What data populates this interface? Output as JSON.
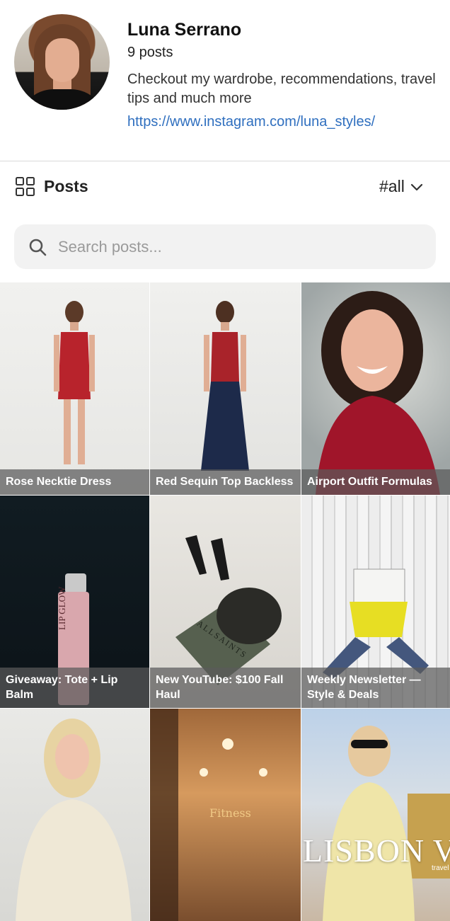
{
  "profile": {
    "name": "Luna Serrano",
    "post_count": "9 posts",
    "bio": "Checkout my wardrobe, recommendations, travel tips and much more",
    "link": "https://www.instagram.com/luna_styles/"
  },
  "posts_bar": {
    "title": "Posts",
    "filter_label": "#all",
    "icons": {
      "grid": "grid-icon",
      "chevron": "chevron-down-icon"
    }
  },
  "search": {
    "placeholder": "Search posts...",
    "value": "",
    "icon": "search-icon"
  },
  "posts": [
    {
      "caption": "Rose Necktie Dress"
    },
    {
      "caption": "Red Sequin Top Backless"
    },
    {
      "caption": "Airport Outfit Formulas"
    },
    {
      "caption": "Giveaway: Tote + Lip Balm"
    },
    {
      "caption": "New YouTube: $100 Fall Haul"
    },
    {
      "caption": "Weekly Newsletter — Style & Deals"
    },
    {
      "caption": ""
    },
    {
      "caption": ""
    },
    {
      "caption": ""
    }
  ],
  "image_text": {
    "lip_glow": "LIP GLOW",
    "allsaints": "ALLSAINTS",
    "fitness": "Fitness",
    "lisbon": "LISBON V",
    "travel": "travel"
  },
  "colors": {
    "link": "#2f6fbf",
    "search_bg": "#f2f2f2",
    "caption_bg": "rgba(90,90,90,0.72)"
  }
}
